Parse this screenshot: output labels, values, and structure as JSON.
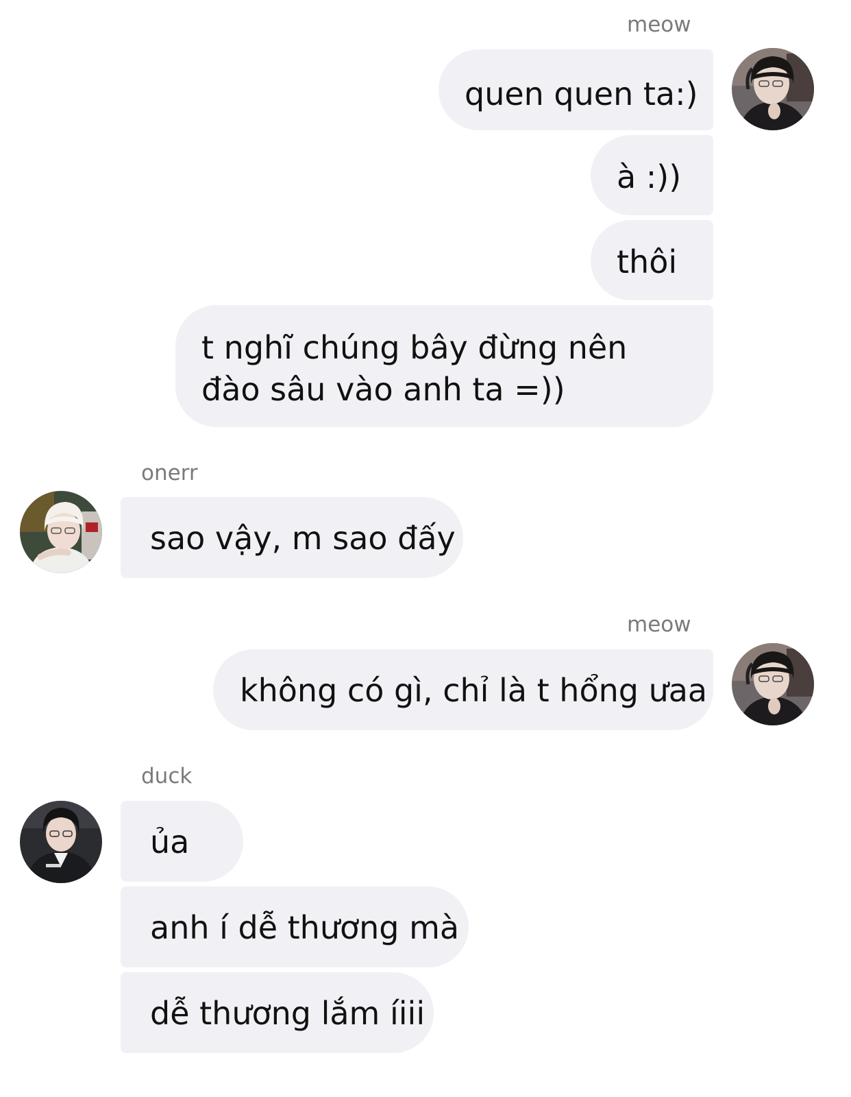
{
  "conversation": {
    "groups": [
      {
        "sender": "meow",
        "side": "right",
        "messages": [
          "quen quen ta:)",
          "à :))",
          "thôi",
          "t nghĩ chúng bây đừng nên đào sâu vào anh ta =))"
        ]
      },
      {
        "sender": "onerr",
        "side": "left",
        "messages": [
          "sao vậy, m sao đấy"
        ]
      },
      {
        "sender": "meow",
        "side": "right",
        "messages": [
          "không có gì, chỉ là t hổng ưaa"
        ]
      },
      {
        "sender": "duck",
        "side": "left",
        "messages": [
          "ủa",
          "anh í dễ thương mà",
          "dễ thương lắm íiii"
        ]
      }
    ]
  },
  "colors": {
    "bubble": "#f1f1f5",
    "name": "#7a7a7e",
    "text": "#111111",
    "background": "#ffffff"
  },
  "icons": {
    "meow_avatar": "avatar-dark-hair-headphones",
    "onerr_avatar": "avatar-white-hair",
    "duck_avatar": "avatar-dark-jacket"
  }
}
